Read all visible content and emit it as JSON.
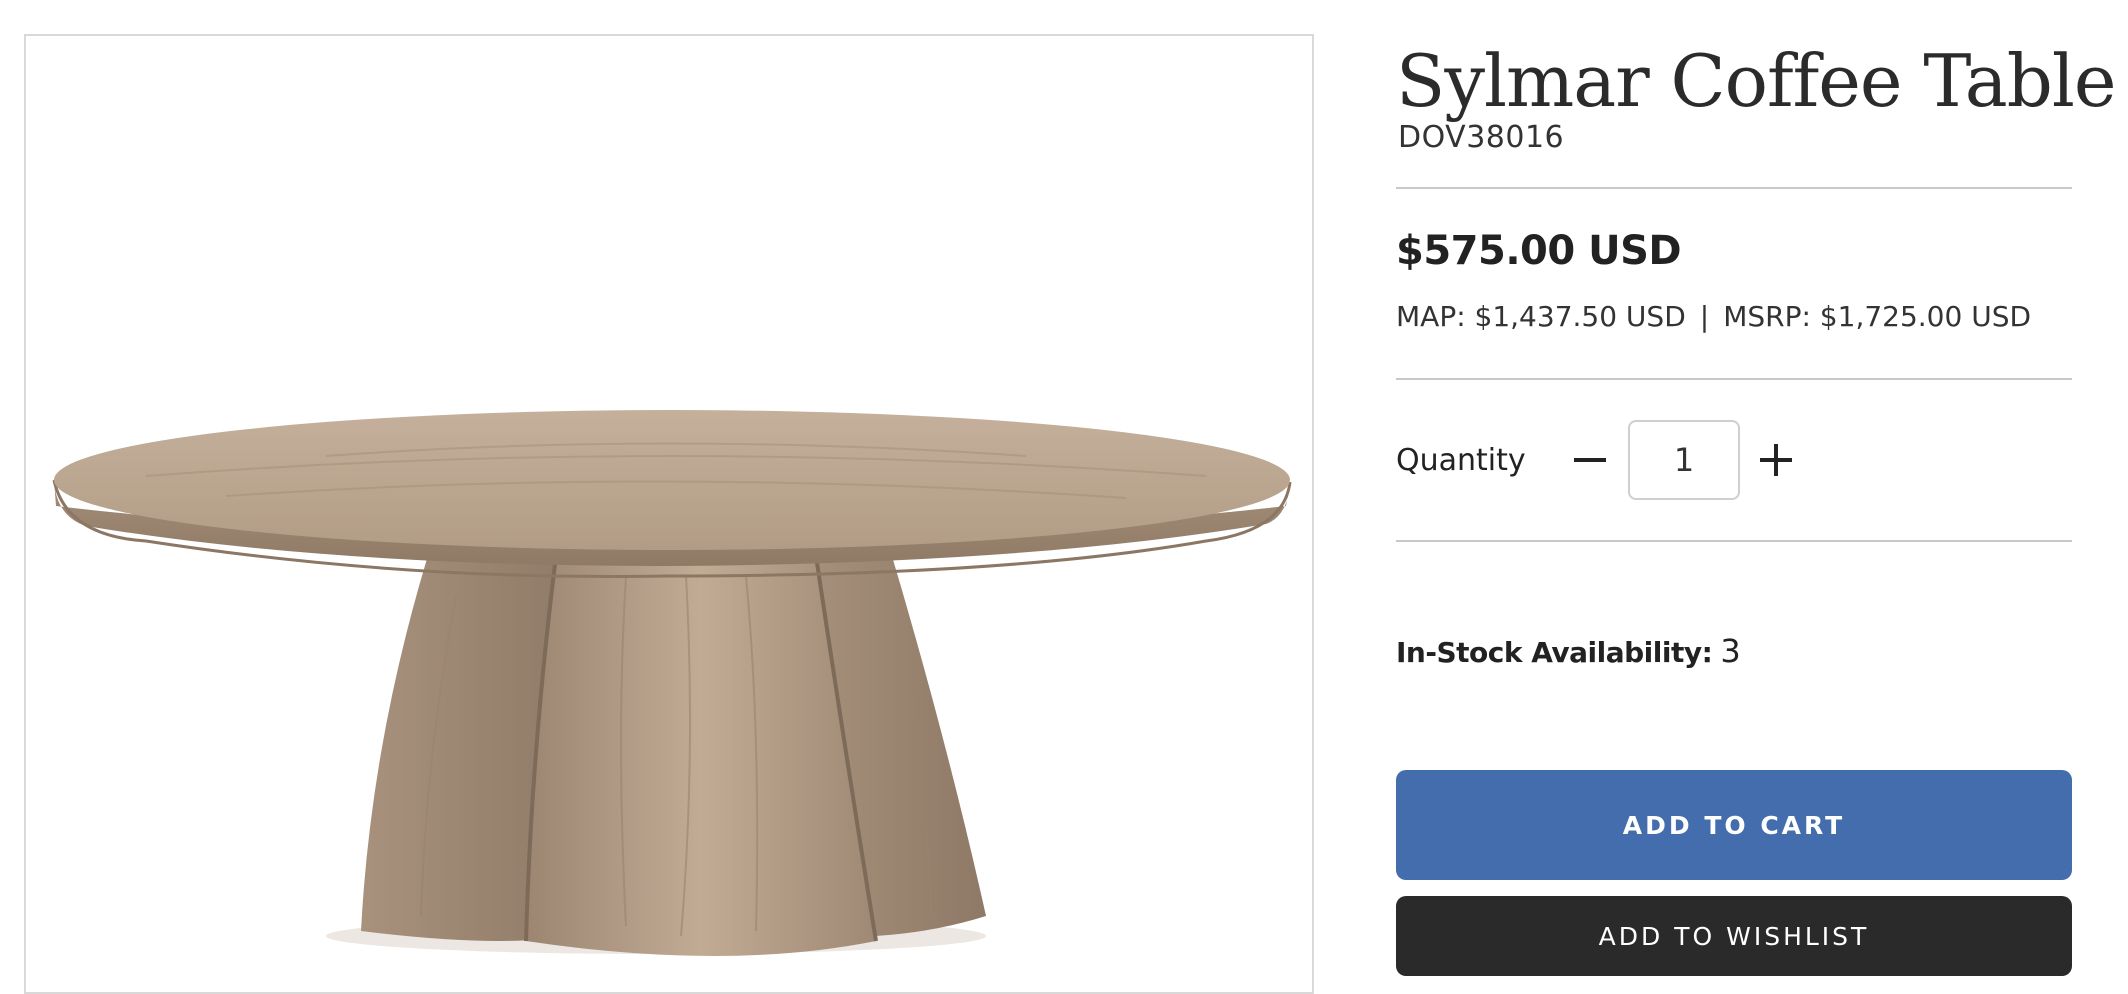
{
  "product": {
    "image_alt": "Sylmar Coffee Table",
    "title": "Sylmar Coffee Table",
    "sku": "DOV38016",
    "price": "$575.00 USD",
    "map": "MAP: $1,437.50 USD",
    "separator": "|",
    "msrp": "MSRP: $1,725.00 USD"
  },
  "quantity": {
    "label": "Quantity",
    "value": "1",
    "decrement_icon": "minus-icon",
    "increment_icon": "plus-icon"
  },
  "stock": {
    "label": "In-Stock Availability:",
    "value": "3"
  },
  "actions": {
    "add_to_cart": "ADD TO CART",
    "add_to_wishlist": "ADD TO WISHLIST"
  },
  "colors": {
    "cart_button": "#436dac",
    "wishlist_button": "#2a2a2a",
    "divider": "#c9c9c9",
    "wood": "#b6a08a"
  }
}
